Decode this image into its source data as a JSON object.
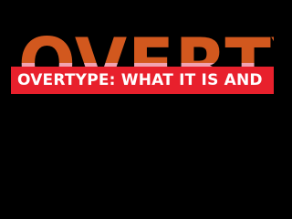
{
  "background_word": "OVERTY",
  "banner": {
    "title": "OVERTYPE: WHAT IT IS AND"
  },
  "colors": {
    "background": "#000000",
    "banner": "#e8202c",
    "banner_text": "#ffffff",
    "word_top": "#d2581e",
    "word_bottom": "#f2a3b1"
  }
}
